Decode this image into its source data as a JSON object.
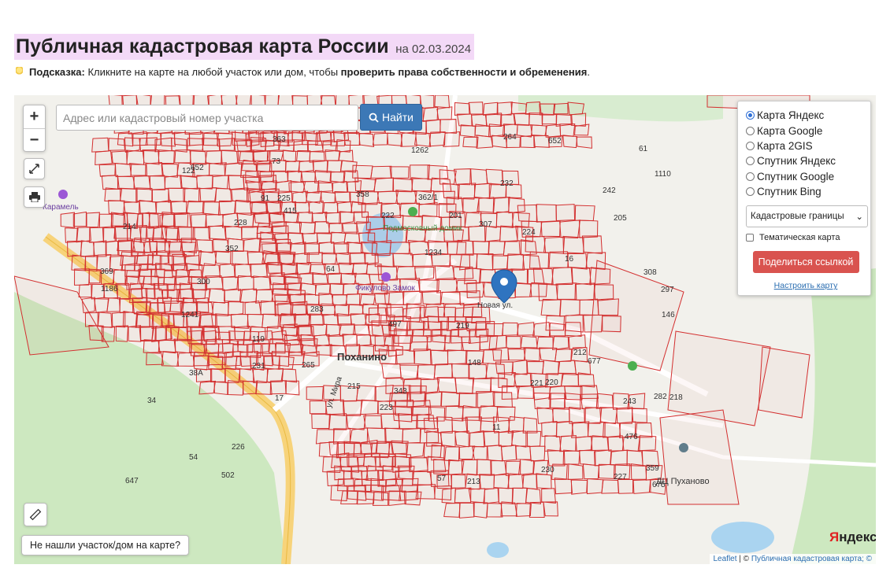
{
  "header": {
    "title": "Публичная кадастровая карта России",
    "date": "на 02.03.2024"
  },
  "hint": {
    "label": "Подсказка:",
    "text_before": " Кликните на карте на любой участок или дом, чтобы ",
    "text_bold": "проверить права собственности и обременения",
    "text_after": "."
  },
  "map": {
    "zoom_in": "+",
    "zoom_out": "−",
    "search": {
      "placeholder": "Адрес или кадастровый номер участка",
      "button": "Найти"
    },
    "layers": {
      "options": [
        "Карта Яндекс",
        "Карта Google",
        "Карта 2GIS",
        "Спутник Яндекс",
        "Спутник Google",
        "Спутник Bing"
      ],
      "selected": "Карта Яндекс",
      "select_value": "Кадастровые границы",
      "thematic_label": "Тематическая карта",
      "share_button": "Поделиться ссылкой",
      "configure_link": "Настроить карту"
    },
    "not_found_button": "Не нашли участок/дом на карте?",
    "attribution": {
      "leaflet": "Leaflet",
      "sep": " | © ",
      "source": "Публичная кадастровая карта; ©"
    },
    "yandex_logo": [
      "Я",
      "ндекс"
    ],
    "places": {
      "village": "Поханино",
      "pond": "Подмосковный домик",
      "cafe": "Фикулово Замок",
      "street_new": "Новая ул.",
      "street_mira": "ул. Мира",
      "dc": "ДЦ Пуханово",
      "karamel": "Карамель"
    },
    "parcel_numbers": [
      "415",
      "308",
      "307",
      "297",
      "283",
      "282",
      "265",
      "264",
      "243",
      "242",
      "352",
      "677",
      "16",
      "17",
      "34",
      "497",
      "119",
      "369",
      "363",
      "358",
      "359",
      "362/1",
      "54",
      "38А",
      "1234",
      "652",
      "647",
      "11",
      "57",
      "1110",
      "502",
      "675",
      "1241",
      "1262",
      "300",
      "1186",
      "146",
      "148",
      "205",
      "212",
      "213",
      "214",
      "215",
      "343",
      "476",
      "122",
      "201",
      "224",
      "225",
      "226",
      "227",
      "228",
      "230",
      "232",
      "231",
      "223",
      "222",
      "221",
      "220",
      "219",
      "218",
      "61",
      "64",
      "73",
      "91",
      "652"
    ],
    "colors": {
      "parcel": "#d32f2f",
      "accent": "#3c78b6",
      "share": "#d9534f",
      "marker": "#2f74c0"
    }
  }
}
